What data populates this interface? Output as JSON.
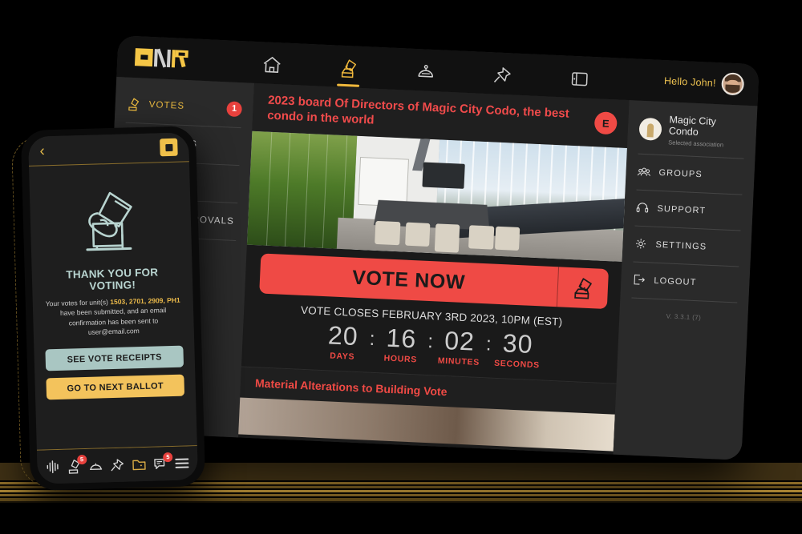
{
  "tablet": {
    "brand": {
      "logo_text": "ONR"
    },
    "topnav": [
      {
        "name": "home",
        "icon": "home-icon",
        "active": false
      },
      {
        "name": "votes",
        "icon": "vote-hand-icon",
        "active": true
      },
      {
        "name": "services",
        "icon": "service-bell-icon",
        "active": false
      },
      {
        "name": "pinned",
        "icon": "push-pin-icon",
        "active": false
      },
      {
        "name": "wallet",
        "icon": "wallet-icon",
        "active": false
      }
    ],
    "greeting": "Hello John!",
    "sidebar_left": [
      {
        "label": "VOTES",
        "icon": "vote-hand-icon",
        "badge": "1",
        "active": true
      },
      {
        "label": "SURVEYS",
        "icon": "survey-clipboard-icon",
        "badge": "",
        "active": false
      },
      {
        "label": "",
        "icon": "",
        "badge": "",
        "active": false
      },
      {
        "label": "APPROVALS",
        "icon": "approvals-icon",
        "badge": "",
        "active": false
      }
    ],
    "hero": {
      "title": "2023 board Of Directors of Magic City Codo, the best condo in the world",
      "seal_letter": "E",
      "photo_alt": "conference-room-photo"
    },
    "vote_now": {
      "label": "VOTE NOW",
      "icon": "vote-hand-icon"
    },
    "closing": "VOTE CLOSES FEBRUARY 3RD 2023, 10PM (EST)",
    "countdown": [
      {
        "value": "20",
        "label": "DAYS"
      },
      {
        "value": "16",
        "label": "HOURS"
      },
      {
        "value": "02",
        "label": "MINUTES"
      },
      {
        "value": "30",
        "label": "SECONDS"
      }
    ],
    "countdown_separator": ":",
    "next_item": {
      "title": "Material Alterations to Building Vote"
    },
    "sidebar_right": {
      "association": {
        "name": "Magic City Condo",
        "subtitle": "Selected association"
      },
      "items": [
        {
          "label": "GROUPS",
          "icon": "groups-icon"
        },
        {
          "label": "SUPPORT",
          "icon": "headset-icon"
        },
        {
          "label": "SETTINGS",
          "icon": "gear-icon"
        },
        {
          "label": "LOGOUT",
          "icon": "logout-icon"
        }
      ],
      "version": "V. 3.3.1 (7)"
    }
  },
  "phone": {
    "back_glyph": "‹",
    "thanks_title": "THANK YOU FOR VOTING!",
    "message_pre": "Your votes for unit(s) ",
    "message_units": "1503, 2701, 2909, PH1",
    "message_post": " have been submitted, and an email confirmation has been sent to user@email.com",
    "buttons": [
      {
        "label": "SEE VOTE RECEIPTS",
        "style": "receipts"
      },
      {
        "label": "GO TO NEXT BALLOT",
        "style": "next"
      }
    ],
    "bottomnav": [
      {
        "name": "activity",
        "icon": "waveform-icon",
        "badge": ""
      },
      {
        "name": "votes",
        "icon": "vote-hand-icon",
        "badge": "5"
      },
      {
        "name": "services",
        "icon": "service-bell-icon",
        "badge": ""
      },
      {
        "name": "pinned",
        "icon": "push-pin-icon",
        "badge": ""
      },
      {
        "name": "documents",
        "icon": "folder-icon",
        "badge": ""
      },
      {
        "name": "messages",
        "icon": "chat-icon",
        "badge": "5"
      },
      {
        "name": "menu",
        "icon": "hamburger-icon",
        "badge": ""
      }
    ]
  },
  "colors": {
    "gold": "#f0c04a",
    "red": "#ef4a45",
    "mint": "#a9c6c2",
    "dark": "#1e1e1e"
  }
}
